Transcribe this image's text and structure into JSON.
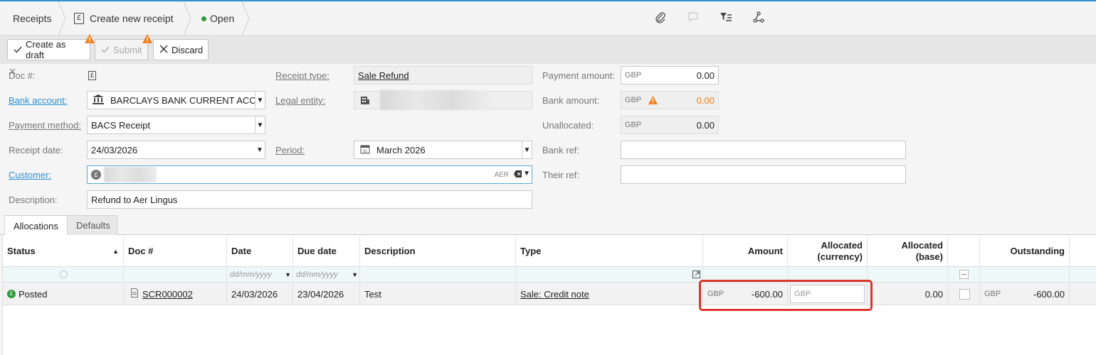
{
  "breadcrumb": {
    "section": "Receipts",
    "page": "Create new receipt",
    "status": "Open",
    "status_color": "#2e9b3c"
  },
  "top_icons": [
    "paperclip-icon",
    "comment-icon",
    "filter-list-icon",
    "share-icon"
  ],
  "toolbar": {
    "create_draft_label": "Create as draft",
    "submit_label": "Submit",
    "discard_label": "Discard",
    "warning_color": "#f0801e"
  },
  "form": {
    "doc_no_label": "Doc #:",
    "bank_account_label": "Bank account:",
    "bank_account_value": "BARCLAYS BANK CURRENT ACCOUNT",
    "payment_method_label": "Payment method:",
    "payment_method_value": "BACS Receipt",
    "receipt_date_label": "Receipt date:",
    "receipt_date_value": "24/03/2026",
    "customer_label": "Customer:",
    "customer_code": "AER",
    "description_label": "Description:",
    "description_value": "Refund to Aer Lingus",
    "receipt_type_label": "Receipt type:",
    "receipt_type_value": "Sale Refund",
    "legal_entity_label": "Legal entity:",
    "period_label": "Period:",
    "period_value": "March 2026",
    "payment_amount_label": "Payment amount:",
    "payment_amount_currency": "GBP",
    "payment_amount_value": "0.00",
    "bank_amount_label": "Bank amount:",
    "bank_amount_currency": "GBP",
    "bank_amount_value": "0.00",
    "unallocated_label": "Unallocated:",
    "unallocated_currency": "GBP",
    "unallocated_value": "0.00",
    "bank_ref_label": "Bank ref:",
    "their_ref_label": "Their ref:"
  },
  "tabs": [
    {
      "label": "Allocations",
      "active": true
    },
    {
      "label": "Defaults",
      "active": false
    }
  ],
  "grid": {
    "headers": {
      "status": "Status",
      "doc_no": "Doc #",
      "date": "Date",
      "due_date": "Due date",
      "description": "Description",
      "type": "Type",
      "amount": "Amount",
      "allocated_currency_1": "Allocated",
      "allocated_currency_2": "(currency)",
      "allocated_base_1": "Allocated",
      "allocated_base_2": "(base)",
      "outstanding": "Outstanding"
    },
    "filter_placeholders": {
      "date": "dd/mm/yyyy",
      "due_date": "dd/mm/yyyy"
    },
    "rows": [
      {
        "status": "Posted",
        "doc_no": "SCR000002",
        "date": "24/03/2026",
        "due_date": "23/04/2026",
        "description": "Test",
        "type": "Sale: Credit note",
        "amount_currency": "GBP",
        "amount": "-600.00",
        "allocated_currency_placeholder": "GBP",
        "allocated_base": "0.00",
        "outstanding_currency": "GBP",
        "outstanding": "-600.00"
      }
    ]
  }
}
